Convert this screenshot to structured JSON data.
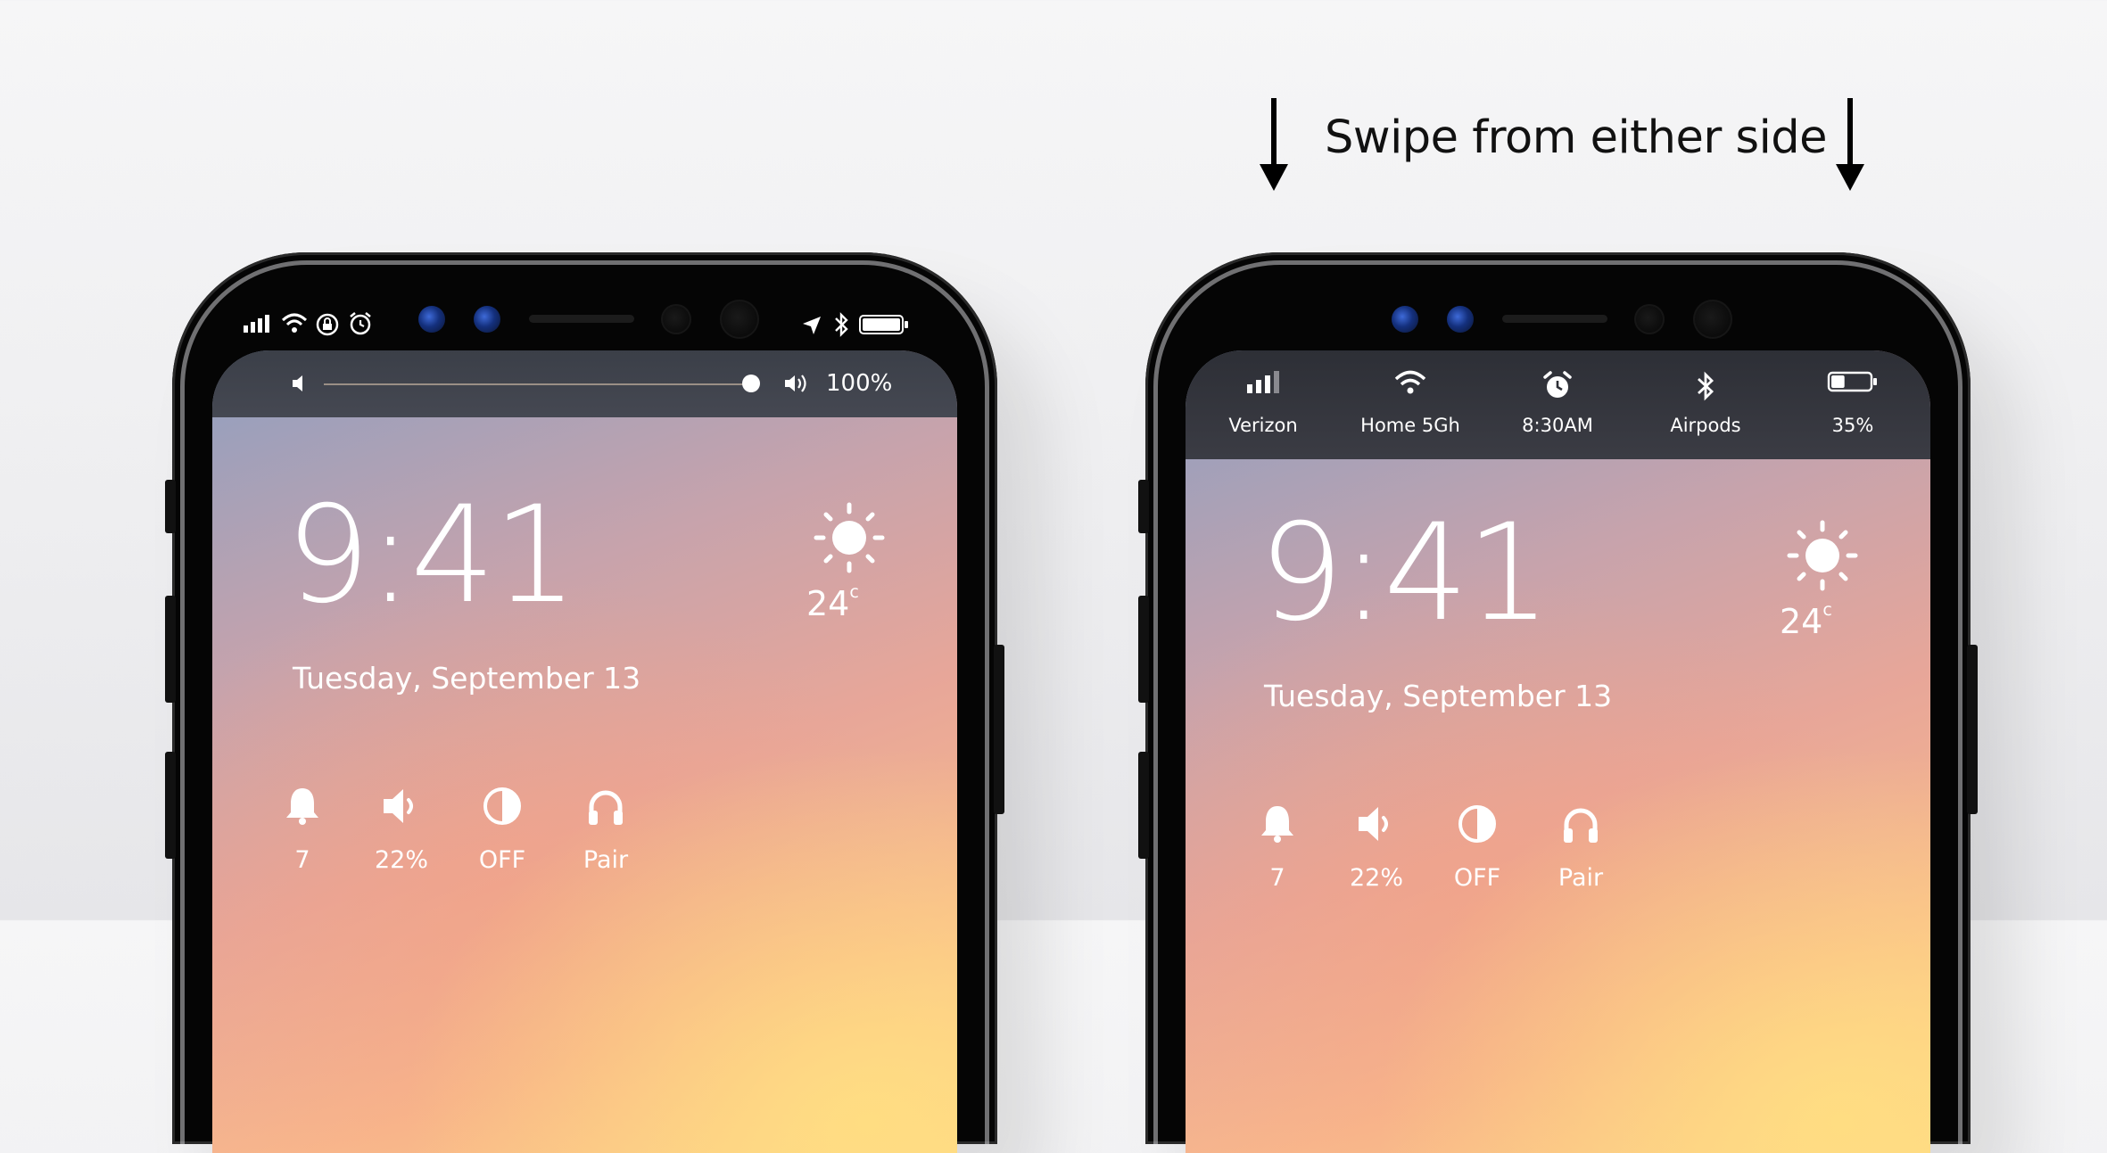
{
  "annotation": {
    "text": "Swipe from either side"
  },
  "left_phone": {
    "status_icons": [
      "cellular-signal-icon",
      "wifi-icon",
      "rotation-lock-icon",
      "alarm-icon",
      "location-arrow-icon",
      "bluetooth-icon",
      "battery-icon"
    ],
    "volume": {
      "level": 1.0,
      "label": "100%"
    },
    "lockscreen": {
      "time": "9:41",
      "date": "Tuesday, September 13",
      "weather": {
        "icon": "sun-icon",
        "temp": "24",
        "unit": "c"
      },
      "quick_actions": [
        {
          "icon": "bell-icon",
          "value": "7"
        },
        {
          "icon": "speaker-icon",
          "value": "22%"
        },
        {
          "icon": "contrast-icon",
          "value": "OFF"
        },
        {
          "icon": "headphones-icon",
          "value": "Pair"
        }
      ]
    }
  },
  "right_phone": {
    "status_panel": [
      {
        "icon": "cellular-signal-icon",
        "label": "Verizon"
      },
      {
        "icon": "wifi-icon",
        "label": "Home 5Gh"
      },
      {
        "icon": "alarm-icon",
        "label": "8:30AM"
      },
      {
        "icon": "bluetooth-icon",
        "label": "Airpods"
      },
      {
        "icon": "battery-icon",
        "label": "35%",
        "level": 0.35
      }
    ],
    "lockscreen": {
      "time": "9:41",
      "date": "Tuesday, September 13",
      "weather": {
        "icon": "sun-icon",
        "temp": "24",
        "unit": "c"
      },
      "quick_actions": [
        {
          "icon": "bell-icon",
          "value": "7"
        },
        {
          "icon": "speaker-icon",
          "value": "22%"
        },
        {
          "icon": "contrast-icon",
          "value": "OFF"
        },
        {
          "icon": "headphones-icon",
          "value": "Pair"
        }
      ]
    }
  }
}
